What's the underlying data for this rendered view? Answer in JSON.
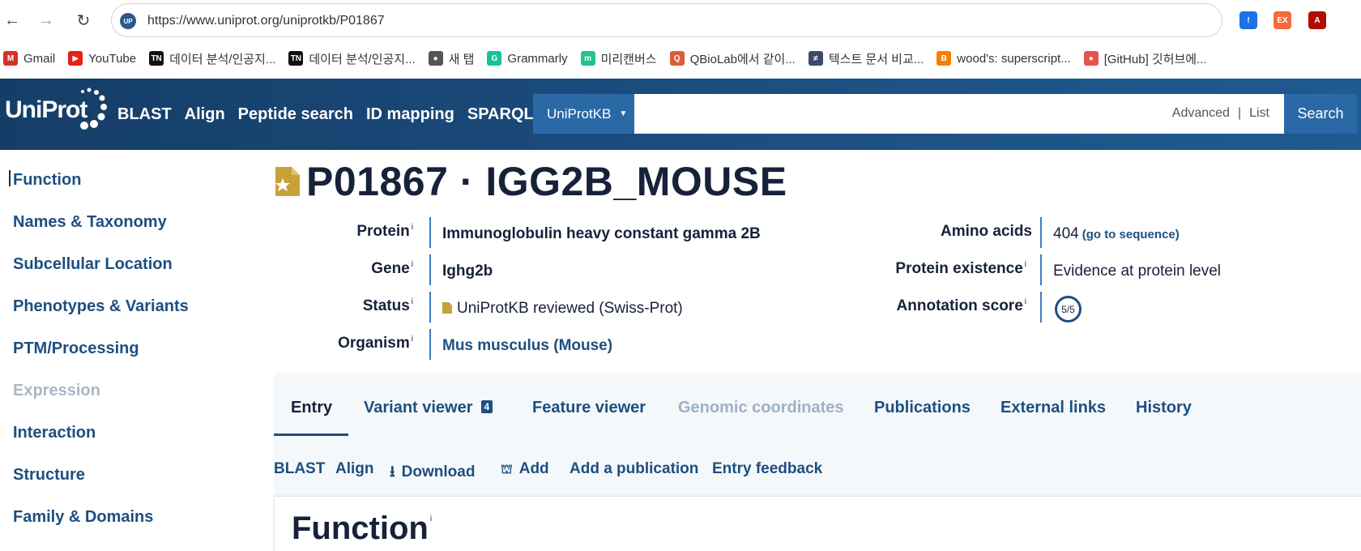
{
  "browser": {
    "back": "←",
    "forward": "→",
    "reload": "↻",
    "url": "https://www.uniprot.org/uniprotkb/P01867",
    "site_icon": "UP",
    "bookmarks": [
      {
        "label": "Gmail",
        "icon": "gmail-icon",
        "color": "#d93025",
        "glyph": "M"
      },
      {
        "label": "YouTube",
        "icon": "youtube-icon",
        "color": "#e62117",
        "glyph": "▶"
      },
      {
        "label": "데이터 분석/인공지...",
        "icon": "tn-icon",
        "color": "#111111",
        "glyph": "TN"
      },
      {
        "label": "데이터 분석/인공지...",
        "icon": "tn-icon",
        "color": "#111111",
        "glyph": "TN"
      },
      {
        "label": "새 탭",
        "icon": "globe-icon",
        "color": "#555555",
        "glyph": "●"
      },
      {
        "label": "Grammarly",
        "icon": "grammarly-icon",
        "color": "#15c39a",
        "glyph": "G"
      },
      {
        "label": "미리캔버스",
        "icon": "miricanvas-icon",
        "color": "#23c38a",
        "glyph": "m"
      },
      {
        "label": "QBioLab에서 같이...",
        "icon": "qbiolab-icon",
        "color": "#e0593a",
        "glyph": "Q"
      },
      {
        "label": "텍스트 문서 비교...",
        "icon": "diff-icon",
        "color": "#3b4a6b",
        "glyph": "≠"
      },
      {
        "label": "wood's: superscript...",
        "icon": "blogger-icon",
        "color": "#f57d00",
        "glyph": "B"
      },
      {
        "label": "[GitHub] 깃허브에...",
        "icon": "github-icon",
        "color": "#e8534a",
        "glyph": "●"
      }
    ],
    "extensions": [
      {
        "icon": "shield-extension-icon",
        "color": "#1a73e8",
        "glyph": "!"
      },
      {
        "icon": "ex-extension-icon",
        "color": "#f26b3a",
        "glyph": "EX"
      },
      {
        "icon": "pdf-extension-icon",
        "color": "#b30b00",
        "glyph": "A"
      }
    ]
  },
  "header": {
    "logo": "UniProt",
    "nav": [
      "BLAST",
      "Align",
      "Peptide search",
      "ID mapping",
      "SPARQL"
    ],
    "db_select": "UniProtKB",
    "search_placeholder": "",
    "advanced": "Advanced",
    "separator": "|",
    "list": "List",
    "search_button": "Search"
  },
  "sidebar": {
    "items": [
      {
        "label": "Function",
        "disabled": false
      },
      {
        "label": "Names & Taxonomy",
        "disabled": false
      },
      {
        "label": "Subcellular Location",
        "disabled": false
      },
      {
        "label": "Phenotypes & Variants",
        "disabled": false
      },
      {
        "label": "PTM/Processing",
        "disabled": false
      },
      {
        "label": "Expression",
        "disabled": true
      },
      {
        "label": "Interaction",
        "disabled": false
      },
      {
        "label": "Structure",
        "disabled": false
      },
      {
        "label": "Family & Domains",
        "disabled": false
      }
    ]
  },
  "entry": {
    "title": "P01867 · IGG2B_MOUSE",
    "info_sup": "i",
    "protein_label": "Protein",
    "protein_value": "Immunoglobulin heavy constant gamma 2B",
    "gene_label": "Gene",
    "gene_value": "Ighg2b",
    "status_label": "Status",
    "status_value": "UniProtKB reviewed (Swiss-Prot)",
    "organism_label": "Organism",
    "organism_value": "Mus musculus (Mouse)",
    "amino_label": "Amino acids",
    "amino_value": "404",
    "amino_link": "(go to sequence)",
    "existence_label": "Protein existence",
    "existence_value": "Evidence at protein level",
    "score_label": "Annotation score",
    "score_value": "5/5"
  },
  "tabs": {
    "entry": "Entry",
    "variant_viewer": "Variant viewer",
    "variant_count": "4",
    "feature_viewer": "Feature viewer",
    "genomic": "Genomic coordinates",
    "publications": "Publications",
    "external": "External links",
    "history": "History"
  },
  "actions": {
    "blast": "BLAST",
    "align": "Align",
    "download": "Download",
    "add": "Add",
    "add_publication": "Add a publication",
    "feedback": "Entry feedback"
  },
  "section": {
    "title": "Function",
    "sup": "i"
  },
  "colors": {
    "header_bg": "#1c5083",
    "link": "#1d4f80",
    "accent_line": "#3a7bbf",
    "reviewed_gold": "#c9a13b"
  }
}
